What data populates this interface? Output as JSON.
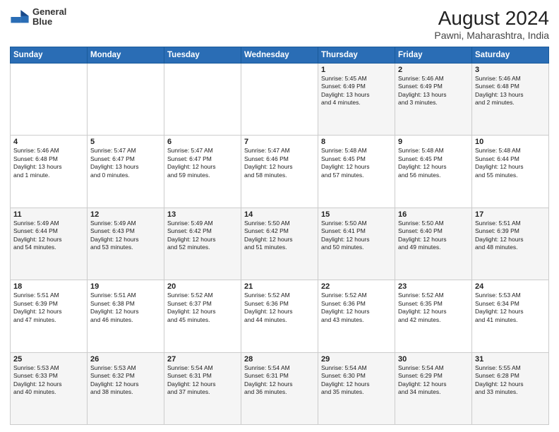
{
  "header": {
    "logo_line1": "General",
    "logo_line2": "Blue",
    "title": "August 2024",
    "subtitle": "Pawni, Maharashtra, India"
  },
  "days_of_week": [
    "Sunday",
    "Monday",
    "Tuesday",
    "Wednesday",
    "Thursday",
    "Friday",
    "Saturday"
  ],
  "weeks": [
    [
      {
        "day": "",
        "info": ""
      },
      {
        "day": "",
        "info": ""
      },
      {
        "day": "",
        "info": ""
      },
      {
        "day": "",
        "info": ""
      },
      {
        "day": "1",
        "info": "Sunrise: 5:45 AM\nSunset: 6:49 PM\nDaylight: 13 hours\nand 4 minutes."
      },
      {
        "day": "2",
        "info": "Sunrise: 5:46 AM\nSunset: 6:49 PM\nDaylight: 13 hours\nand 3 minutes."
      },
      {
        "day": "3",
        "info": "Sunrise: 5:46 AM\nSunset: 6:48 PM\nDaylight: 13 hours\nand 2 minutes."
      }
    ],
    [
      {
        "day": "4",
        "info": "Sunrise: 5:46 AM\nSunset: 6:48 PM\nDaylight: 13 hours\nand 1 minute."
      },
      {
        "day": "5",
        "info": "Sunrise: 5:47 AM\nSunset: 6:47 PM\nDaylight: 13 hours\nand 0 minutes."
      },
      {
        "day": "6",
        "info": "Sunrise: 5:47 AM\nSunset: 6:47 PM\nDaylight: 12 hours\nand 59 minutes."
      },
      {
        "day": "7",
        "info": "Sunrise: 5:47 AM\nSunset: 6:46 PM\nDaylight: 12 hours\nand 58 minutes."
      },
      {
        "day": "8",
        "info": "Sunrise: 5:48 AM\nSunset: 6:45 PM\nDaylight: 12 hours\nand 57 minutes."
      },
      {
        "day": "9",
        "info": "Sunrise: 5:48 AM\nSunset: 6:45 PM\nDaylight: 12 hours\nand 56 minutes."
      },
      {
        "day": "10",
        "info": "Sunrise: 5:48 AM\nSunset: 6:44 PM\nDaylight: 12 hours\nand 55 minutes."
      }
    ],
    [
      {
        "day": "11",
        "info": "Sunrise: 5:49 AM\nSunset: 6:44 PM\nDaylight: 12 hours\nand 54 minutes."
      },
      {
        "day": "12",
        "info": "Sunrise: 5:49 AM\nSunset: 6:43 PM\nDaylight: 12 hours\nand 53 minutes."
      },
      {
        "day": "13",
        "info": "Sunrise: 5:49 AM\nSunset: 6:42 PM\nDaylight: 12 hours\nand 52 minutes."
      },
      {
        "day": "14",
        "info": "Sunrise: 5:50 AM\nSunset: 6:42 PM\nDaylight: 12 hours\nand 51 minutes."
      },
      {
        "day": "15",
        "info": "Sunrise: 5:50 AM\nSunset: 6:41 PM\nDaylight: 12 hours\nand 50 minutes."
      },
      {
        "day": "16",
        "info": "Sunrise: 5:50 AM\nSunset: 6:40 PM\nDaylight: 12 hours\nand 49 minutes."
      },
      {
        "day": "17",
        "info": "Sunrise: 5:51 AM\nSunset: 6:39 PM\nDaylight: 12 hours\nand 48 minutes."
      }
    ],
    [
      {
        "day": "18",
        "info": "Sunrise: 5:51 AM\nSunset: 6:39 PM\nDaylight: 12 hours\nand 47 minutes."
      },
      {
        "day": "19",
        "info": "Sunrise: 5:51 AM\nSunset: 6:38 PM\nDaylight: 12 hours\nand 46 minutes."
      },
      {
        "day": "20",
        "info": "Sunrise: 5:52 AM\nSunset: 6:37 PM\nDaylight: 12 hours\nand 45 minutes."
      },
      {
        "day": "21",
        "info": "Sunrise: 5:52 AM\nSunset: 6:36 PM\nDaylight: 12 hours\nand 44 minutes."
      },
      {
        "day": "22",
        "info": "Sunrise: 5:52 AM\nSunset: 6:36 PM\nDaylight: 12 hours\nand 43 minutes."
      },
      {
        "day": "23",
        "info": "Sunrise: 5:52 AM\nSunset: 6:35 PM\nDaylight: 12 hours\nand 42 minutes."
      },
      {
        "day": "24",
        "info": "Sunrise: 5:53 AM\nSunset: 6:34 PM\nDaylight: 12 hours\nand 41 minutes."
      }
    ],
    [
      {
        "day": "25",
        "info": "Sunrise: 5:53 AM\nSunset: 6:33 PM\nDaylight: 12 hours\nand 40 minutes."
      },
      {
        "day": "26",
        "info": "Sunrise: 5:53 AM\nSunset: 6:32 PM\nDaylight: 12 hours\nand 38 minutes."
      },
      {
        "day": "27",
        "info": "Sunrise: 5:54 AM\nSunset: 6:31 PM\nDaylight: 12 hours\nand 37 minutes."
      },
      {
        "day": "28",
        "info": "Sunrise: 5:54 AM\nSunset: 6:31 PM\nDaylight: 12 hours\nand 36 minutes."
      },
      {
        "day": "29",
        "info": "Sunrise: 5:54 AM\nSunset: 6:30 PM\nDaylight: 12 hours\nand 35 minutes."
      },
      {
        "day": "30",
        "info": "Sunrise: 5:54 AM\nSunset: 6:29 PM\nDaylight: 12 hours\nand 34 minutes."
      },
      {
        "day": "31",
        "info": "Sunrise: 5:55 AM\nSunset: 6:28 PM\nDaylight: 12 hours\nand 33 minutes."
      }
    ]
  ]
}
